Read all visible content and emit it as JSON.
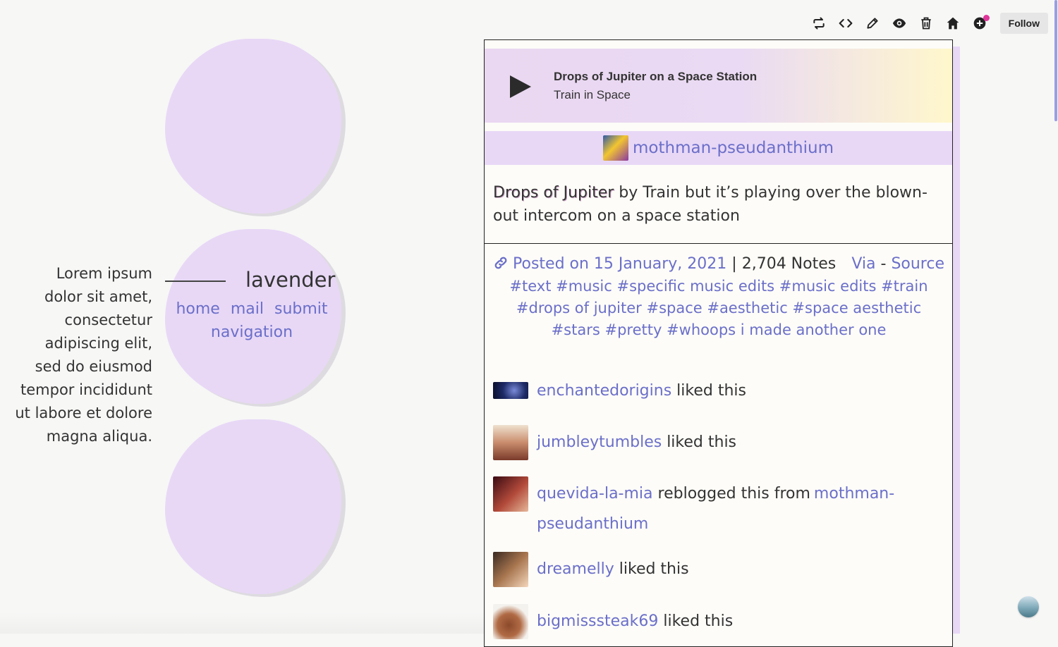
{
  "sidebar": {
    "lorem": "Lorem ipsum dolor sit amet, consectetur adipiscing elit, sed do eiusmod tempor incididunt ut labore et dolore magna aliqua.",
    "site_title": "lavender",
    "nav": [
      "home",
      "mail",
      "submit",
      "navigation"
    ]
  },
  "toolbar": {
    "icons": [
      "reblog-icon",
      "embed-icon",
      "edit-icon",
      "eye-icon",
      "trash-icon",
      "home-icon",
      "messages-icon"
    ],
    "follow_label": "Follow"
  },
  "post": {
    "audio": {
      "title": "Drops of Jupiter on a Space Station",
      "artist": "Train in Space"
    },
    "author": "mothman-pseudanthium",
    "caption": {
      "song": "Drops of Jupiter",
      "rest": " by Train but it’s playing over the blown-out intercom on a space station"
    },
    "meta": {
      "posted": "Posted on 15 January, 2021",
      "separator": " | ",
      "notes": "2,704 Notes",
      "via": "Via",
      "dash": " - ",
      "source": "Source"
    },
    "tags": "#text #music #specific music edits #music edits #train #drops of jupiter #space #aesthetic #space aesthetic #stars #pretty #whoops i made another one"
  },
  "notes": [
    {
      "user": "enchantedorigins",
      "action": " liked this"
    },
    {
      "user": "jumbleytumbles",
      "action": " liked this"
    },
    {
      "user": "quevida-la-mia",
      "action": " reblogged this from ",
      "from": "mothman-pseudanthium"
    },
    {
      "user": "dreamelly",
      "action": " liked this"
    },
    {
      "user": "bigmisssteak69",
      "action": " liked this"
    }
  ],
  "colors": {
    "lavender": "#e8d8f6",
    "link": "#6b6fc9",
    "text": "#333333",
    "notif_dot": "#e0359a"
  }
}
